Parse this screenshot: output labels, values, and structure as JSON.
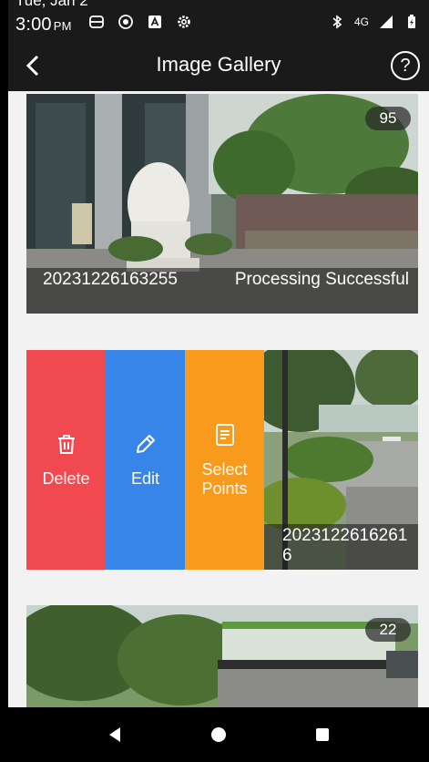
{
  "status_bar": {
    "date": "Tue, Jan 2",
    "time": "3:00",
    "ampm": "PM",
    "network": "4G",
    "network_sup": "4G"
  },
  "header": {
    "title": "Image Gallery",
    "help_glyph": "?"
  },
  "gallery": {
    "items": [
      {
        "id": "20231226163255",
        "status": "Processing Successful",
        "count": "95"
      },
      {
        "id": "20231226162616"
      },
      {
        "count": "22"
      }
    ]
  },
  "swipe_actions": {
    "delete_label": "Delete",
    "edit_label": "Edit",
    "select_points_label": "Select Points"
  },
  "colors": {
    "delete": "#f0494f",
    "edit": "#3785e8",
    "select_points": "#f89b1c"
  },
  "icons": {
    "back": "chevron-left-icon",
    "help": "question-circle-icon",
    "delete": "trash-icon",
    "edit": "pencil-icon",
    "select_points": "document-list-icon"
  }
}
